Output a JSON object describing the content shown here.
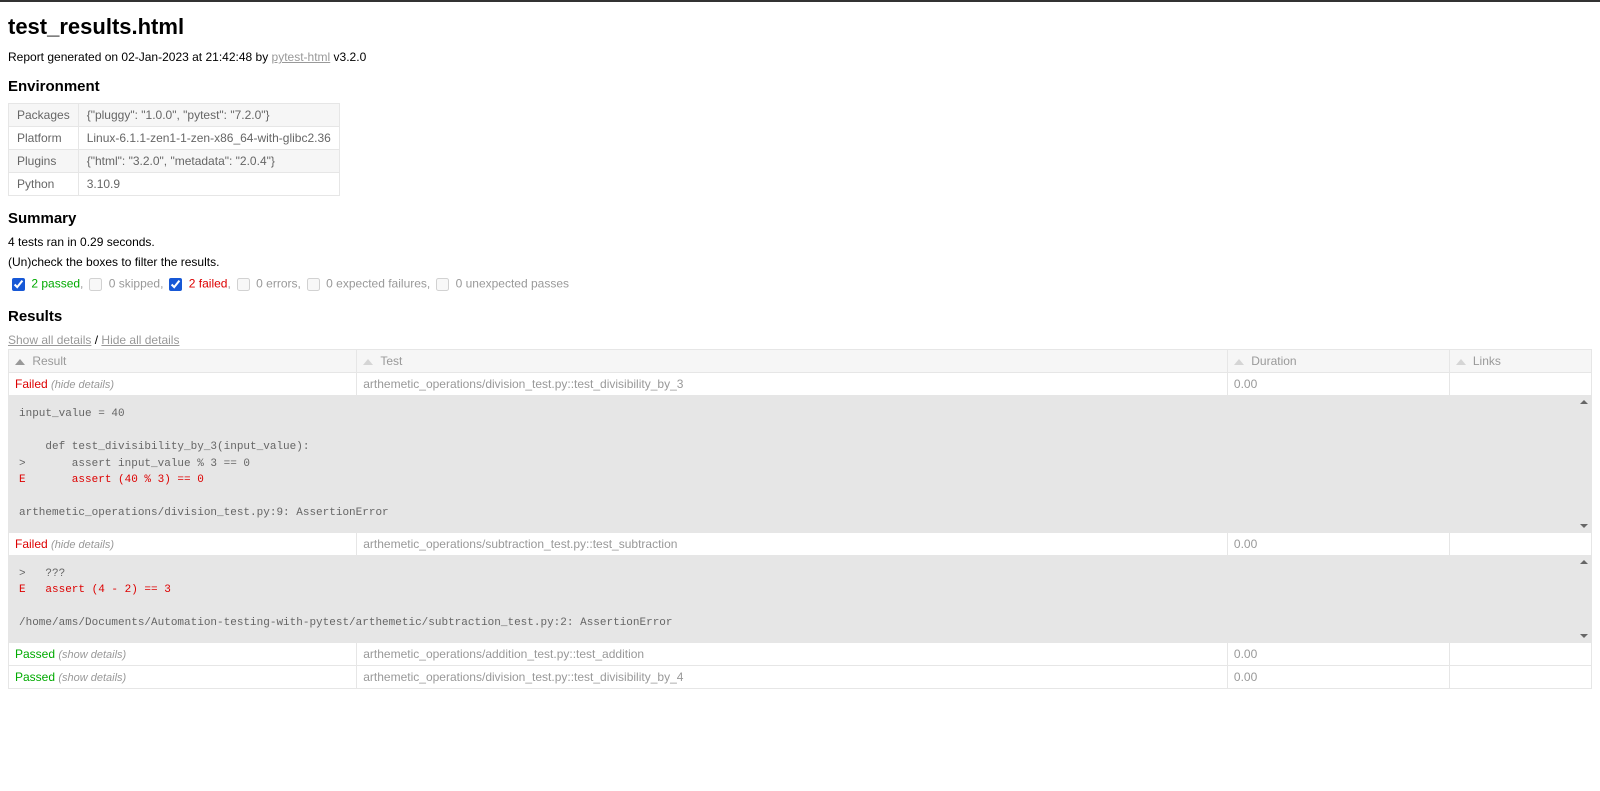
{
  "title": "test_results.html",
  "generated_prefix": "Report generated on 02-Jan-2023 at 21:42:48 by ",
  "generator_link": "pytest-html",
  "generator_version": " v3.2.0",
  "sections": {
    "environment": "Environment",
    "summary": "Summary",
    "results": "Results"
  },
  "environment": [
    {
      "key": "Packages",
      "value": "{\"pluggy\": \"1.0.0\", \"pytest\": \"7.2.0\"}"
    },
    {
      "key": "Platform",
      "value": "Linux-6.1.1-zen1-1-zen-x86_64-with-glibc2.36"
    },
    {
      "key": "Plugins",
      "value": "{\"html\": \"3.2.0\", \"metadata\": \"2.0.4\"}"
    },
    {
      "key": "Python",
      "value": "3.10.9"
    }
  ],
  "summary": {
    "ran": "4 tests ran in 0.29 seconds.",
    "filter_hint": "(Un)check the boxes to filter the results.",
    "filters": {
      "passed": {
        "label": "2 passed",
        "checked": true,
        "enabled": true,
        "class": "passed"
      },
      "skipped": {
        "label": "0 skipped",
        "checked": false,
        "enabled": false,
        "class": "skipped"
      },
      "failed": {
        "label": "2 failed",
        "checked": true,
        "enabled": true,
        "class": "failed"
      },
      "errors": {
        "label": "0 errors",
        "checked": false,
        "enabled": false,
        "class": "error"
      },
      "xfailed": {
        "label": "0 expected failures",
        "checked": false,
        "enabled": false,
        "class": "xfailed"
      },
      "xpassed": {
        "label": "0 unexpected passes",
        "checked": false,
        "enabled": false,
        "class": "xpassed"
      }
    }
  },
  "toggle": {
    "show_all": "Show all details",
    "sep": " / ",
    "hide_all": "Hide all details"
  },
  "columns": {
    "result": "Result",
    "test": "Test",
    "duration": "Duration",
    "links": "Links"
  },
  "details_labels": {
    "hide": "(hide details)",
    "show": "(show details)"
  },
  "rows": [
    {
      "result": "Failed",
      "result_class": "failed",
      "details_mode": "hide",
      "test": "arthemetic_operations/division_test.py::test_divisibility_by_3",
      "duration": "0.00",
      "links": "",
      "log_plain": "input_value = 40\n\n    def test_divisibility_by_3(input_value):\n>       assert input_value % 3 == 0\n",
      "log_err": "E       assert (40 % 3) == 0\n",
      "log_tail": "\narthemetic_operations/division_test.py:9: AssertionError"
    },
    {
      "result": "Failed",
      "result_class": "failed",
      "details_mode": "hide",
      "test": "arthemetic_operations/subtraction_test.py::test_subtraction",
      "duration": "0.00",
      "links": "",
      "log_plain": ">   ???\n",
      "log_err": "E   assert (4 - 2) == 3\n",
      "log_tail": "\n/home/ams/Documents/Automation-testing-with-pytest/arthemetic/subtraction_test.py:2: AssertionError"
    },
    {
      "result": "Passed",
      "result_class": "passed",
      "details_mode": "show",
      "test": "arthemetic_operations/addition_test.py::test_addition",
      "duration": "0.00",
      "links": ""
    },
    {
      "result": "Passed",
      "result_class": "passed",
      "details_mode": "show",
      "test": "arthemetic_operations/division_test.py::test_divisibility_by_4",
      "duration": "0.00",
      "links": ""
    }
  ]
}
